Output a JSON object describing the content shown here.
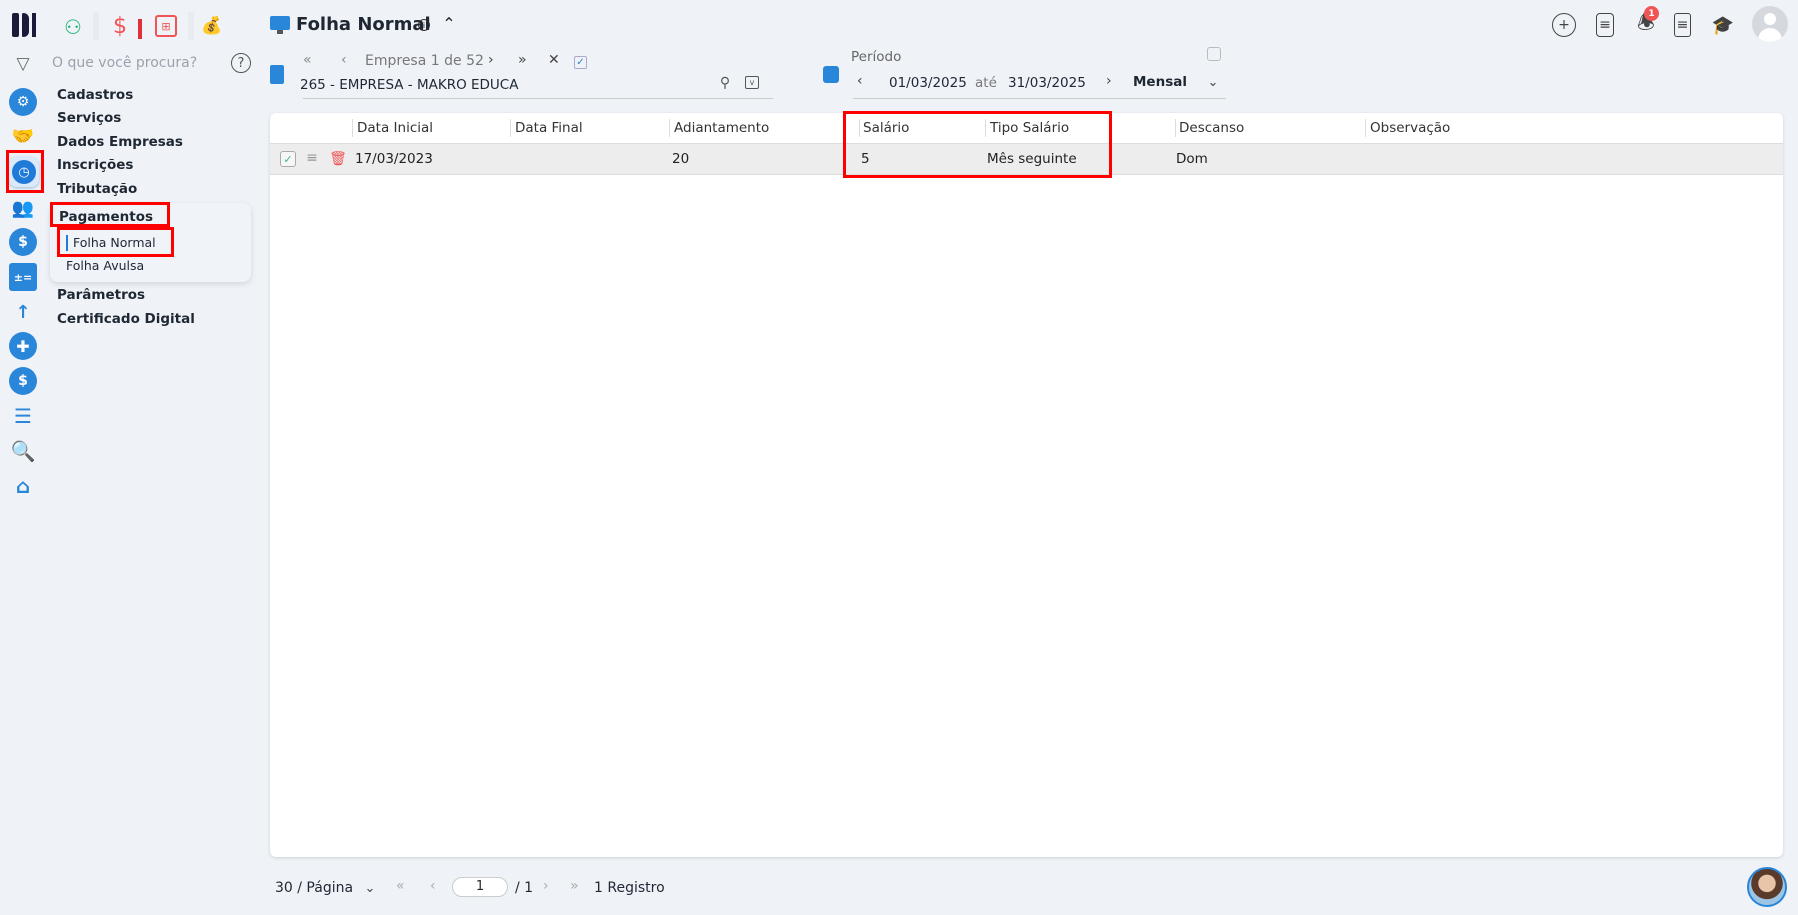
{
  "header": {
    "title": "Folha Normal",
    "notifications_count": "1"
  },
  "search": {
    "placeholder": "O que você procura?"
  },
  "company_nav": {
    "label": "Empresa 1 de 52",
    "company": "265 - EMPRESA - MAKRO EDUCA"
  },
  "period": {
    "label": "Período",
    "start": "01/03/2025",
    "separator": "até",
    "end": "31/03/2025",
    "mode": "Mensal"
  },
  "menu": {
    "items": [
      "Cadastros",
      "Serviços",
      "Dados Empresas",
      "Inscrições",
      "Tributação"
    ],
    "group": "Pagamentos",
    "subitems": [
      "Folha Normal",
      "Folha Avulsa"
    ],
    "items_after": [
      "Parâmetros",
      "Certificado Digital"
    ]
  },
  "table": {
    "columns": [
      "Data Inicial",
      "Data Final",
      "Adiantamento",
      "Salário",
      "Tipo Salário",
      "Descanso",
      "Observação"
    ],
    "rows": [
      {
        "data_inicial": "17/03/2023",
        "data_final": "",
        "adiantamento": "20",
        "salario": "5",
        "tipo_salario": "Mês seguinte",
        "descanso": "Dom",
        "observacao": ""
      }
    ]
  },
  "footer": {
    "page_size": "30 / Página",
    "page": "1",
    "total_pages": "/ 1",
    "records": "1 Registro"
  },
  "colors": {
    "accent": "#2a86d9",
    "highlight": "#ff0000"
  }
}
